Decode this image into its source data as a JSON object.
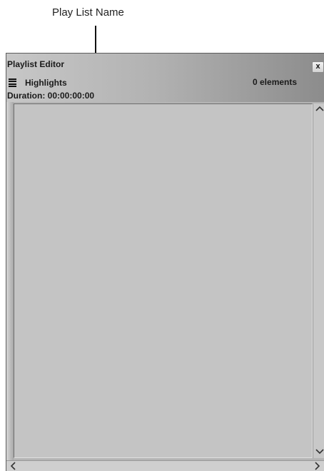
{
  "annotation": {
    "label": "Play List Name"
  },
  "window": {
    "title": "Playlist Editor",
    "close_label": "x"
  },
  "playlist": {
    "name": "Highlights",
    "element_count": "0 elements",
    "duration": "Duration: 00:00:00:00"
  },
  "scrollbars": {
    "up_icon": "chevron-up-icon",
    "down_icon": "chevron-down-icon",
    "left_icon": "chevron-left-icon",
    "right_icon": "chevron-right-icon"
  }
}
